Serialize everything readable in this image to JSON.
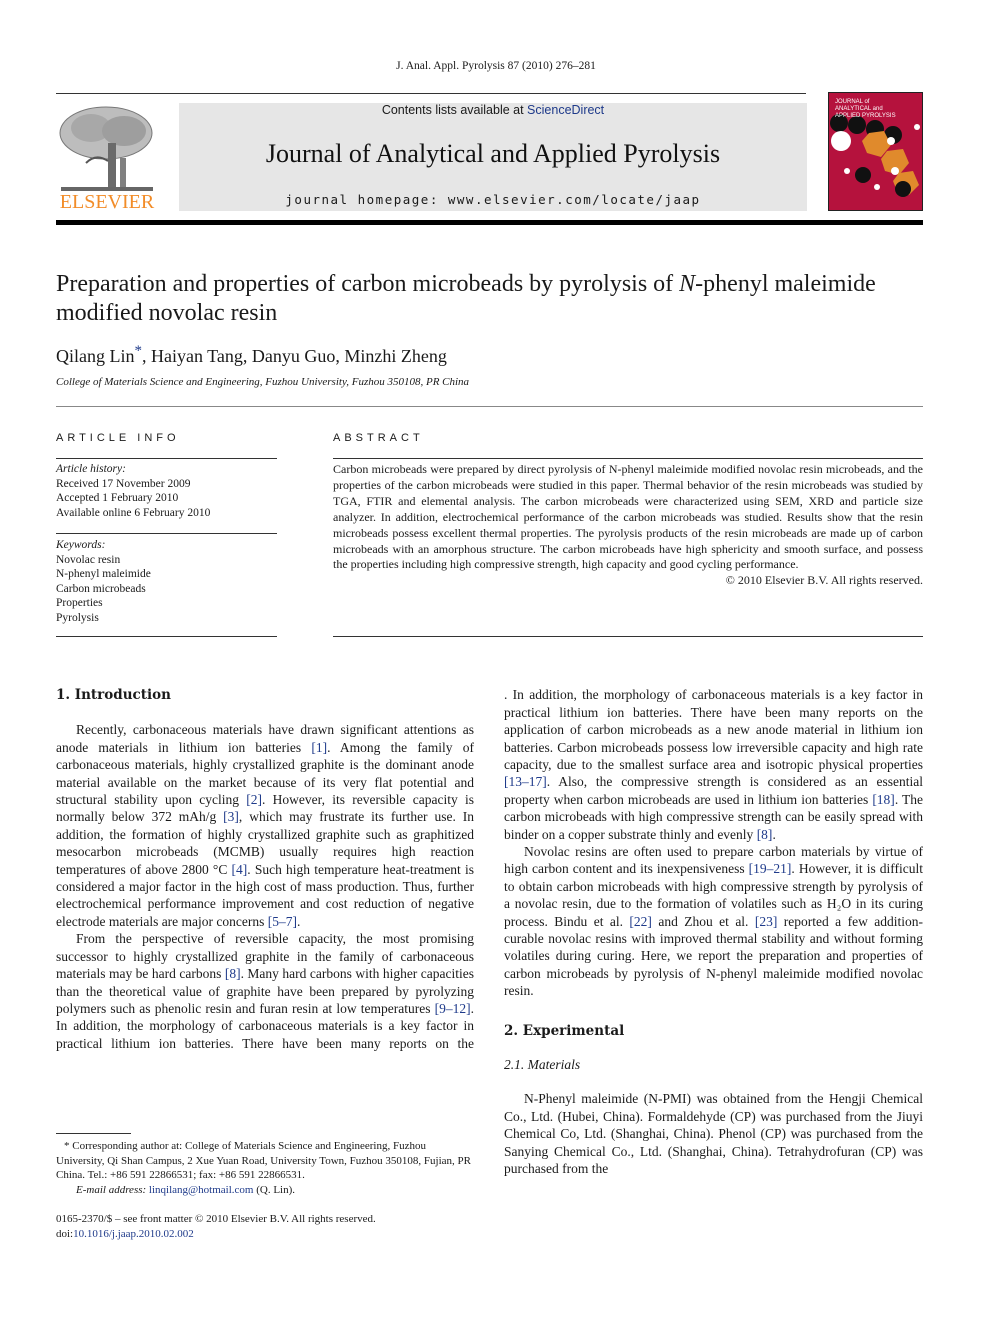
{
  "header": {
    "citation": "J. Anal. Appl.  Pyrolysis  87 (2010) 276–281",
    "contents_prefix": "Contents lists available at ",
    "contents_link": "ScienceDirect",
    "journal_title": "Journal of Analytical and Applied Pyrolysis",
    "homepage": "journal homepage: www.elsevier.com/locate/jaap",
    "publisher_logo": "ELSEVIER",
    "cover_title_lines": [
      "JOURNAL of",
      "ANALYTICAL and",
      "APPLIED PYROLYSIS"
    ],
    "colors": {
      "elsevier_orange": "#f28c28",
      "cover_red": "#b5123d",
      "link_blue": "#1e3a8a"
    }
  },
  "article": {
    "title_part1": "Preparation and properties of carbon microbeads by pyrolysis of ",
    "title_italic": "N",
    "title_part2": "-phenyl maleimide modified novolac resin",
    "authors": "Qilang Lin",
    "author_star": "*",
    "authors_rest": ", Haiyan Tang, Danyu Guo, Minzhi Zheng",
    "affiliation": "College of Materials Science and Engineering, Fuzhou University, Fuzhou 350108, PR China"
  },
  "article_info": {
    "heading": "ARTICLE INFO",
    "history_label": "Article history:",
    "history": [
      "Received 17 November 2009",
      "Accepted 1 February 2010",
      "Available online 6 February 2010"
    ],
    "keywords_label": "Keywords:",
    "keywords": [
      "Novolac resin",
      "N-phenyl maleimide",
      "Carbon microbeads",
      "Properties",
      "Pyrolysis"
    ]
  },
  "abstract": {
    "heading": "ABSTRACT",
    "text": "Carbon microbeads were prepared by direct pyrolysis of N-phenyl maleimide modified novolac resin microbeads, and the properties of the carbon microbeads were studied in this paper. Thermal behavior of the resin microbeads was studied by TGA, FTIR and elemental analysis. The carbon microbeads were characterized using SEM, XRD and particle size analyzer. In addition, electrochemical performance of the carbon microbeads was studied. Results show that the resin microbeads possess excellent thermal properties. The pyrolysis products of the resin microbeads are made up of carbon microbeads with an amorphous structure. The carbon microbeads have high sphericity and smooth surface, and possess the properties including high compressive strength, high capacity and good cycling performance.",
    "copyright": "© 2010 Elsevier B.V. All rights reserved."
  },
  "intro": {
    "heading": "1.  Introduction",
    "p1": [
      "Recently, carbonaceous materials have drawn significant attentions as anode materials in lithium ion batteries ",
      "[1]",
      ". Among the family of carbonaceous materials, highly crystallized graphite is the dominant anode material available on the market because of its very flat potential and structural stability upon cycling ",
      "[2]",
      ". However, its reversible capacity is normally below 372 mAh/g ",
      "[3]",
      ", which may frustrate its further use. In addition, the formation of highly crystallized graphite such as graphitized mesocarbon microbeads (MCMB) usually requires high reaction temperatures of above 2800 °C ",
      "[4]",
      ". Such high temperature heat-treatment is considered a major factor in the high cost of mass production. Thus, further electrochemical performance improvement and cost reduction of negative electrode materials are major concerns ",
      "[5–7]",
      "."
    ],
    "p2": [
      "From the perspective of reversible capacity, the most promising successor to highly crystallized graphite in the family of carbonaceous materials may be hard carbons ",
      "[8]",
      ". Many hard carbons with higher capacities than the theoretical value of graphite have been prepared by pyrolyzing polymers such as phenolic resin and furan resin at low temperatures ",
      "[9–12]",
      ". In addition, the morphology of carbonaceous materials is a key factor in practical lithium ion batteries. There have been many reports on the application of carbon microbeads as a new anode material in lithium ion batteries. Carbon microbeads possess low irreversible capacity and high rate capacity, due to the smallest surface area and isotropic physical properties ",
      "[13–17]",
      ". Also, the compressive strength is considered as an essential property when carbon microbeads are used in lithium ion batteries ",
      "[18]",
      ". The carbon microbeads with high compressive strength can be easily spread with binder on a copper substrate thinly and evenly ",
      "[8]",
      "."
    ],
    "p3": [
      "Novolac resins are often used to prepare carbon materials by virtue of high carbon content and its inexpensiveness ",
      "[19–21]",
      ". However, it is difficult to obtain carbon microbeads with high compressive strength by pyrolysis of a novolac resin, due to the formation of volatiles such as H₂O in its curing process. Bindu et al. ",
      "[22]",
      " and Zhou et al. ",
      "[23]",
      " reported a few addition-curable novolac resins with improved thermal stability and without forming volatiles during curing. Here, we report the preparation and properties of carbon microbeads by pyrolysis of N-phenyl maleimide modified novolac resin."
    ]
  },
  "experimental": {
    "heading": "2.  Experimental",
    "sub_heading": "2.1.  Materials",
    "p1": "N-Phenyl maleimide (N-PMI) was obtained from the Hengji Chemical Co., Ltd. (Hubei, China). Formaldehyde (CP) was purchased from the Jiuyi Chemical Co, Ltd. (Shanghai, China). Phenol (CP) was purchased from the Sanying Chemical Co., Ltd. (Shanghai, China). Tetrahydrofuran (CP) was purchased from the"
  },
  "footnote": {
    "corresponding": "* Corresponding author at: College of Materials Science and Engineering, Fuzhou University, Qi Shan Campus, 2 Xue Yuan Road, University Town, Fuzhou 350108, Fujian, PR China. Tel.: +86 591 22866531; fax: +86 591 22866531.",
    "email_label": "E-mail address: ",
    "email": "linqilang@hotmail.com",
    "email_suffix": " (Q. Lin).",
    "issn": "0165-2370/$ – see front matter © 2010 Elsevier B.V. All rights reserved.",
    "doi_label": "doi:",
    "doi": "10.1016/j.jaap.2010.02.002"
  }
}
